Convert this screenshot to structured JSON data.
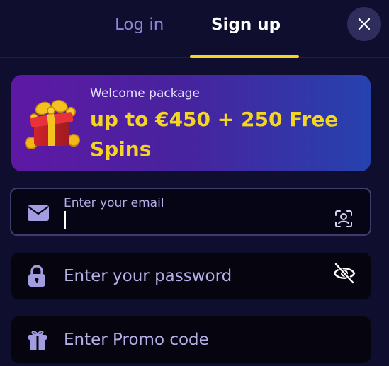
{
  "tabs": {
    "login": "Log in",
    "signup": "Sign up",
    "active": "signup"
  },
  "banner": {
    "label": "Welcome package",
    "offer": "up to €450 + 250 Free Spins"
  },
  "email": {
    "label": "Enter your email",
    "value": ""
  },
  "password": {
    "placeholder": "Enter your password"
  },
  "promo": {
    "placeholder": "Enter Promo code"
  },
  "icons": {
    "close": "close-icon",
    "gift_banner": "gift-box-icon",
    "email": "envelope-icon",
    "face_scan": "face-scan-icon",
    "lock": "lock-icon",
    "visibility": "eye-off-icon",
    "promo": "gift-icon"
  },
  "colors": {
    "background": "#0f0e2e",
    "accent_yellow": "#f4d51f",
    "tab_inactive": "#8b86d9",
    "placeholder": "#b4afe6",
    "field_bg": "#05040f"
  }
}
